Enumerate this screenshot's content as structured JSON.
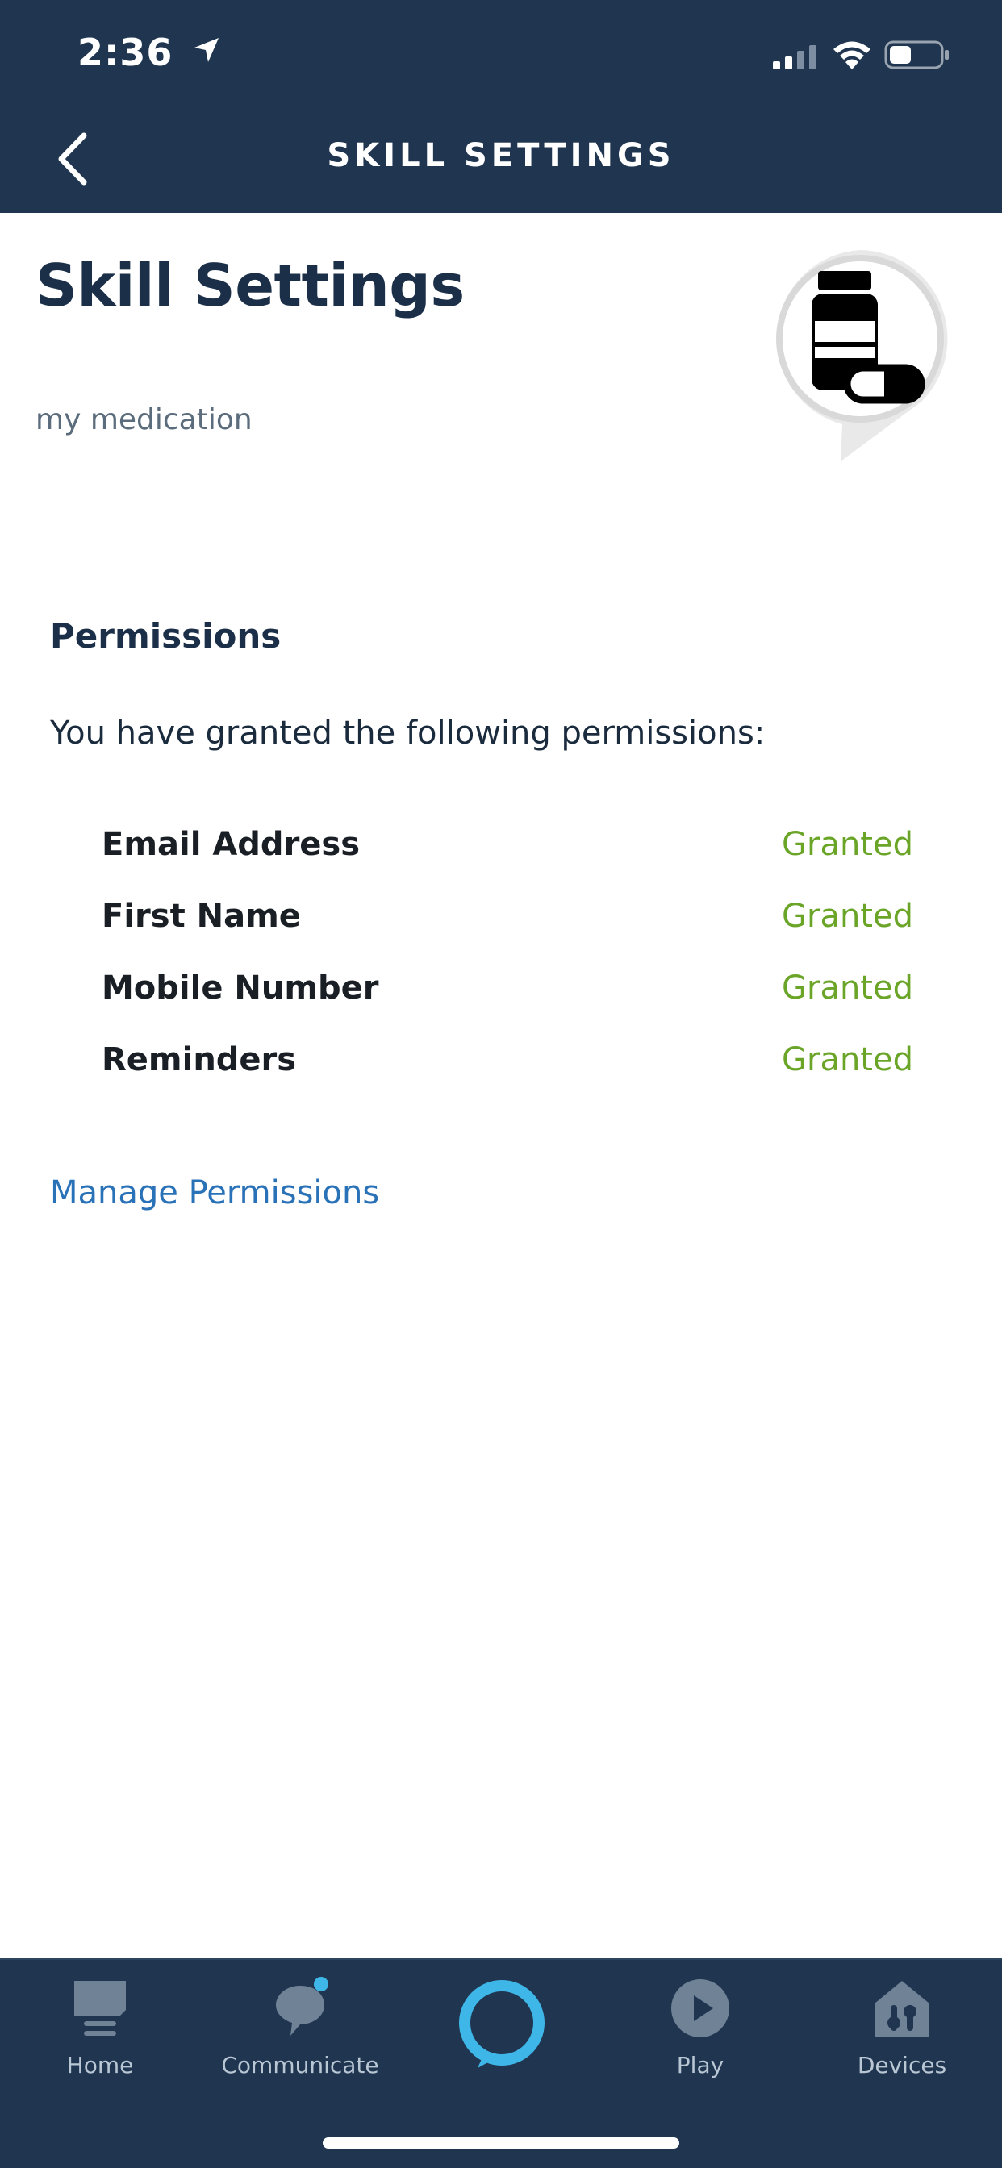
{
  "status_bar": {
    "time": "2:36"
  },
  "nav": {
    "title": "SKILL SETTINGS",
    "back_icon": "chevron-left-icon"
  },
  "skill": {
    "title": "Skill Settings",
    "name": "my medication",
    "icon": "medication-bottle-icon"
  },
  "permissions": {
    "heading": "Permissions",
    "description": "You have granted the following permissions:",
    "items": [
      {
        "name": "Email Address",
        "status": "Granted"
      },
      {
        "name": "First Name",
        "status": "Granted"
      },
      {
        "name": "Mobile Number",
        "status": "Granted"
      },
      {
        "name": "Reminders",
        "status": "Granted"
      }
    ],
    "manage_label": "Manage Permissions"
  },
  "tabbar": {
    "home_label": "Home",
    "communicate_label": "Communicate",
    "play_label": "Play",
    "devices_label": "Devices"
  },
  "colors": {
    "header_bg": "#1f3550",
    "granted": "#6aa528",
    "link": "#2a72b8",
    "alexa_ring": "#3fb6e8"
  }
}
